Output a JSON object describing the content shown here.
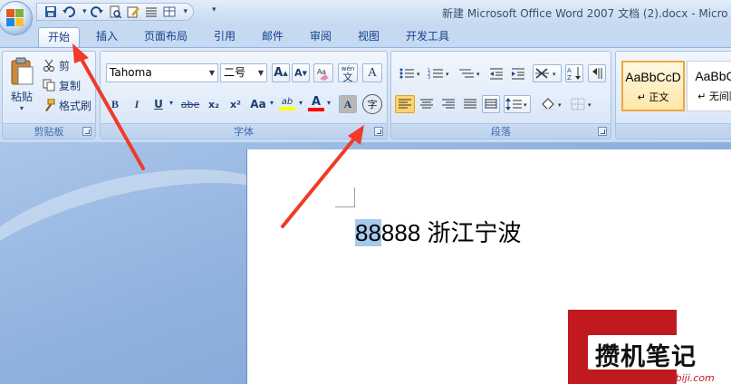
{
  "window": {
    "title": "新建 Microsoft Office Word 2007 文档 (2).docx - Micro"
  },
  "quick_access": {
    "items": [
      "save-icon",
      "undo-icon",
      "redo-icon",
      "print-preview-icon",
      "edit-icon",
      "paragraph-icon",
      "table-icon"
    ],
    "customize": "▾"
  },
  "tabs": [
    "开始",
    "插入",
    "页面布局",
    "引用",
    "邮件",
    "审阅",
    "视图",
    "开发工具"
  ],
  "active_tab": "开始",
  "clipboard": {
    "label": "剪贴板",
    "paste": "粘贴",
    "cut": "剪",
    "copy": "复制",
    "format_painter": "格式刷"
  },
  "font": {
    "label": "字体",
    "font_name": "Tahoma",
    "font_size": "二号",
    "grow": "A",
    "shrink": "A",
    "bold": "B",
    "italic": "I",
    "underline": "U",
    "strikethrough": "abe",
    "subscript": "x₂",
    "superscript": "x²",
    "change_case": "Aa",
    "highlight": "ab",
    "font_color": "A",
    "char_shading": "A",
    "enclose": "字",
    "phonetic": "wén",
    "phonetic_char": "文",
    "char_border": "A"
  },
  "paragraph": {
    "label": "段落"
  },
  "styles": {
    "items": [
      {
        "preview": "AaBbCcD",
        "name": "↵ 正文",
        "selected": true
      },
      {
        "preview": "AaBbCc",
        "name": "↵ 无间隔",
        "selected": false
      }
    ]
  },
  "document": {
    "highlighted_text": "88",
    "rest_text": "888 浙江宁波"
  },
  "watermark": {
    "text": "攒机笔记",
    "url": "www.cuanjibiji.com"
  },
  "colors": {
    "accent": "#15428b",
    "selection": "#a8c9ee",
    "arrow": "#f03a2a",
    "highlight_bar": "#ffff00",
    "font_color_bar": "#ff0000"
  }
}
